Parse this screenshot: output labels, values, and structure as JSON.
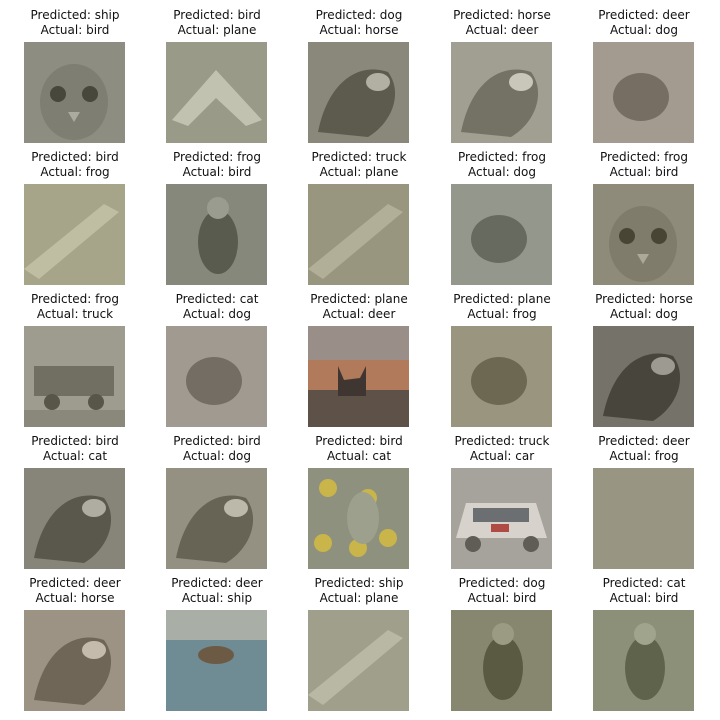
{
  "grid": {
    "items": [
      {
        "predicted": "Predicted: ship",
        "actual": "Actual: bird",
        "tone": "#8d8d82",
        "motif": "face"
      },
      {
        "predicted": "Predicted: bird",
        "actual": "Actual: plane",
        "tone": "#9a9a88",
        "motif": "plane"
      },
      {
        "predicted": "Predicted: dog",
        "actual": "Actual: horse",
        "tone": "#8a877b",
        "motif": "animal"
      },
      {
        "predicted": "Predicted: horse",
        "actual": "Actual: deer",
        "tone": "#a19f91",
        "motif": "animal"
      },
      {
        "predicted": "Predicted: deer",
        "actual": "Actual: dog",
        "tone": "#a39a90",
        "motif": "blob"
      },
      {
        "predicted": "Predicted: bird",
        "actual": "Actual: frog",
        "tone": "#a7a589",
        "motif": "diagonal"
      },
      {
        "predicted": "Predicted: frog",
        "actual": "Actual: bird",
        "tone": "#87887c",
        "motif": "bird"
      },
      {
        "predicted": "Predicted: truck",
        "actual": "Actual: plane",
        "tone": "#99967f",
        "motif": "diagonal"
      },
      {
        "predicted": "Predicted: frog",
        "actual": "Actual: dog",
        "tone": "#94988c",
        "motif": "blob"
      },
      {
        "predicted": "Predicted: frog",
        "actual": "Actual: bird",
        "tone": "#8f8b7a",
        "motif": "face"
      },
      {
        "predicted": "Predicted: frog",
        "actual": "Actual: truck",
        "tone": "#9e9c8e",
        "motif": "truck"
      },
      {
        "predicted": "Predicted: cat",
        "actual": "Actual: dog",
        "tone": "#a19a91",
        "motif": "blob"
      },
      {
        "predicted": "Predicted: plane",
        "actual": "Actual: deer",
        "tone": "#8d7f70",
        "motif": "sunset"
      },
      {
        "predicted": "Predicted: plane",
        "actual": "Actual: frog",
        "tone": "#99957f",
        "motif": "blob"
      },
      {
        "predicted": "Predicted: horse",
        "actual": "Actual: dog",
        "tone": "#75726a",
        "motif": "animal"
      },
      {
        "predicted": "Predicted: bird",
        "actual": "Actual: cat",
        "tone": "#878579",
        "motif": "animal"
      },
      {
        "predicted": "Predicted: bird",
        "actual": "Actual: dog",
        "tone": "#959182",
        "motif": "animal"
      },
      {
        "predicted": "Predicted: bird",
        "actual": "Actual: cat",
        "tone": "#8e917d",
        "motif": "flowers"
      },
      {
        "predicted": "Predicted: truck",
        "actual": "Actual: car",
        "tone": "#a6a29c",
        "motif": "car"
      },
      {
        "predicted": "Predicted: deer",
        "actual": "Actual: frog",
        "tone": "#989683",
        "motif": "plain"
      },
      {
        "predicted": "Predicted: deer",
        "actual": "Actual: horse",
        "tone": "#9c9384",
        "motif": "animal"
      },
      {
        "predicted": "Predicted: deer",
        "actual": "Actual: ship",
        "tone": "#8e9a98",
        "motif": "sea"
      },
      {
        "predicted": "Predicted: ship",
        "actual": "Actual: plane",
        "tone": "#9f9f8c",
        "motif": "diagonal"
      },
      {
        "predicted": "Predicted: dog",
        "actual": "Actual: bird",
        "tone": "#87876f",
        "motif": "bird"
      },
      {
        "predicted": "Predicted: cat",
        "actual": "Actual: bird",
        "tone": "#8d9079",
        "motif": "bird"
      }
    ]
  }
}
